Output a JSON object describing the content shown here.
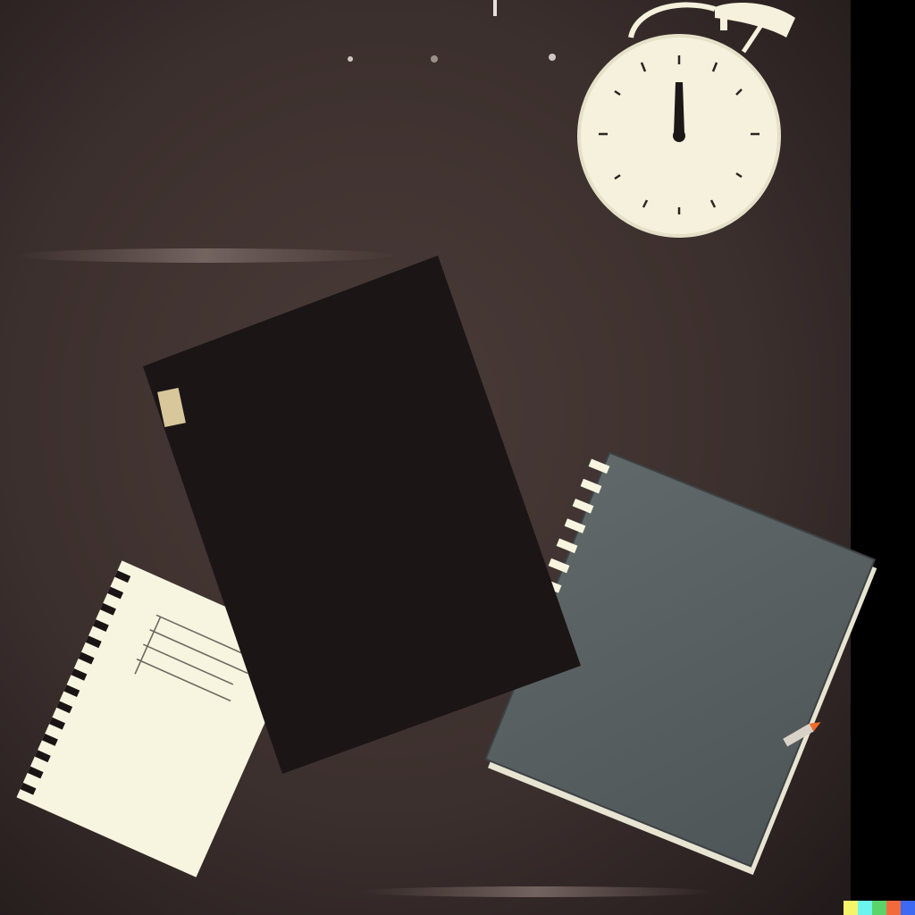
{
  "scene": {
    "description_tokens": [],
    "colors": {
      "background_dark": "#2a2121",
      "background_mid": "#443634",
      "right_band": "#000000",
      "clock_face": "#f5f1dc",
      "clock_ink": "#1c1818",
      "black_notebook": "#1b1516",
      "grey_notebook": "#5a6163",
      "paper": "#f7f5df",
      "tape": "#d8c79a"
    },
    "icons": [
      "alarm-clock-icon",
      "notebook-icon",
      "notepad-icon",
      "pencil-icon"
    ]
  },
  "color_strip": {
    "colors": [
      "#f5f56a",
      "#6af5ef",
      "#5ad46a",
      "#f26a3c",
      "#3c6af2"
    ]
  }
}
